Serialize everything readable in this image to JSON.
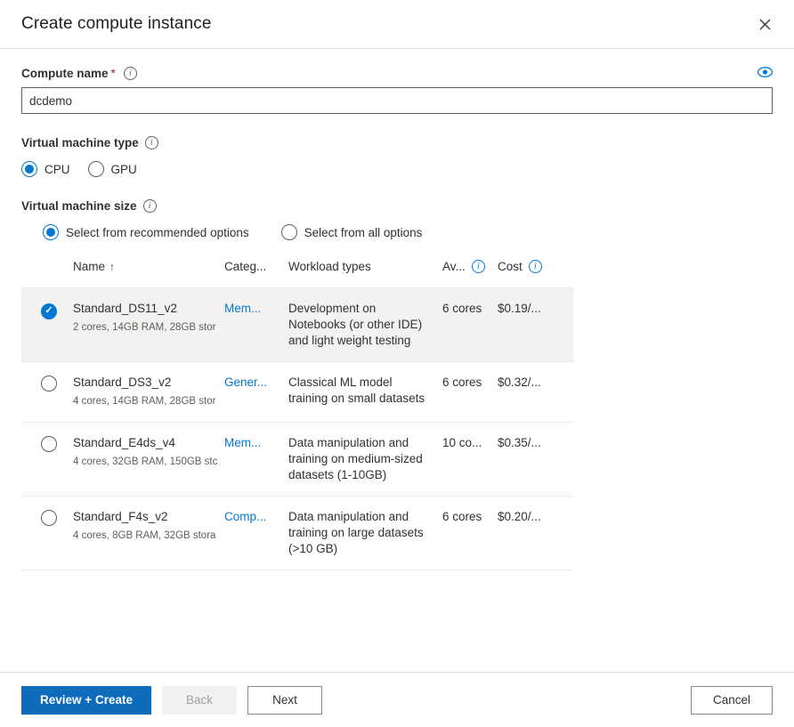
{
  "header": {
    "title": "Create compute instance",
    "close_icon": "close-icon"
  },
  "compute_name": {
    "label": "Compute name",
    "required_marker": "*",
    "info_icon": "info-icon",
    "eye_icon": "eye-icon",
    "value": "dcdemo",
    "placeholder": ""
  },
  "vm_type": {
    "label": "Virtual machine type",
    "info_icon": "info-icon",
    "options": [
      {
        "label": "CPU",
        "checked": true
      },
      {
        "label": "GPU",
        "checked": false
      }
    ]
  },
  "vm_size": {
    "label": "Virtual machine size",
    "info_icon": "info-icon",
    "options": [
      {
        "label": "Select from recommended options",
        "checked": true
      },
      {
        "label": "Select from all options",
        "checked": false
      }
    ]
  },
  "table": {
    "columns": {
      "name": "Name",
      "name_sort": "↑",
      "category": "Categ...",
      "workload": "Workload types",
      "available": "Av...",
      "cost": "Cost"
    },
    "rows": [
      {
        "selected": true,
        "name": "Standard_DS11_v2",
        "specs": "2 cores, 14GB RAM, 28GB stor",
        "category": "Mem...",
        "workload": "Development on Notebooks (or other IDE) and light weight testing",
        "available": "6 cores",
        "cost": "$0.19/..."
      },
      {
        "selected": false,
        "name": "Standard_DS3_v2",
        "specs": "4 cores, 14GB RAM, 28GB stor",
        "category": "Gener...",
        "workload": "Classical ML model training on small datasets",
        "available": "6 cores",
        "cost": "$0.32/..."
      },
      {
        "selected": false,
        "name": "Standard_E4ds_v4",
        "specs": "4 cores, 32GB RAM, 150GB stc",
        "category": "Mem...",
        "workload": "Data manipulation and training on medium-sized datasets (1-10GB)",
        "available": "10 co...",
        "cost": "$0.35/..."
      },
      {
        "selected": false,
        "name": "Standard_F4s_v2",
        "specs": "4 cores, 8GB RAM, 32GB stora",
        "category": "Comp...",
        "workload": "Data manipulation and training on large datasets (>10 GB)",
        "available": "6 cores",
        "cost": "$0.20/..."
      }
    ]
  },
  "footer": {
    "review_create": "Review + Create",
    "back": "Back",
    "next": "Next",
    "cancel": "Cancel"
  },
  "colors": {
    "accent": "#0078d4",
    "primary_button": "#0f6cbd",
    "required": "#a4262c",
    "selected_row_bg": "#f3f2f1"
  }
}
